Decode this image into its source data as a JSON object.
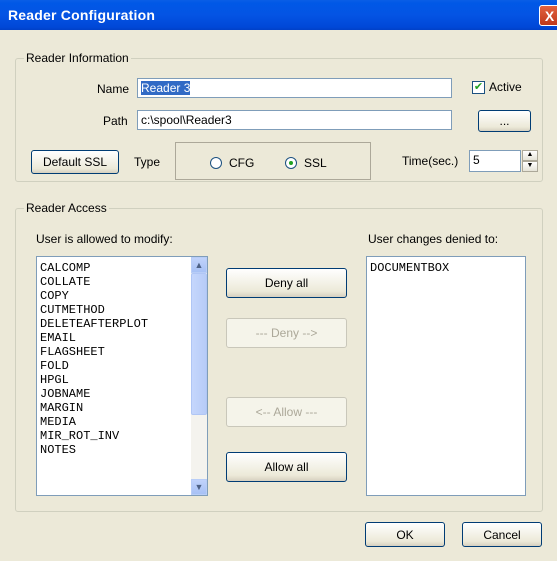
{
  "window": {
    "title": "Reader Configuration",
    "close_glyph": "X"
  },
  "reader_info": {
    "legend": "Reader Information",
    "name_label": "Name",
    "name_value": "Reader 3",
    "active_label": "Active",
    "active_checked": true,
    "path_label": "Path",
    "path_value": "c:\\spool\\Reader3",
    "browse_label": "...",
    "default_ssl_label": "Default SSL",
    "type_label": "Type",
    "type_options": [
      "CFG",
      "SSL"
    ],
    "type_selected": "SSL",
    "time_label": "Time(sec.)",
    "time_value": "5"
  },
  "reader_access": {
    "legend": "Reader Access",
    "allowed_label": "User is allowed to modify:",
    "denied_label": "User changes denied to:",
    "allowed_items": [
      "CALCOMP",
      "COLLATE",
      "COPY",
      "CUTMETHOD",
      "DELETEAFTERPLOT",
      "EMAIL",
      "FLAGSHEET",
      "FOLD",
      "HPGL",
      "JOBNAME",
      "MARGIN",
      "MEDIA",
      "MIR_ROT_INV",
      "NOTES"
    ],
    "denied_items": [
      "DOCUMENTBOX"
    ],
    "deny_all_label": "Deny all",
    "deny_label": "--- Deny -->",
    "allow_label": "<-- Allow ---",
    "allow_all_label": "Allow all"
  },
  "footer": {
    "ok_label": "OK",
    "cancel_label": "Cancel"
  }
}
